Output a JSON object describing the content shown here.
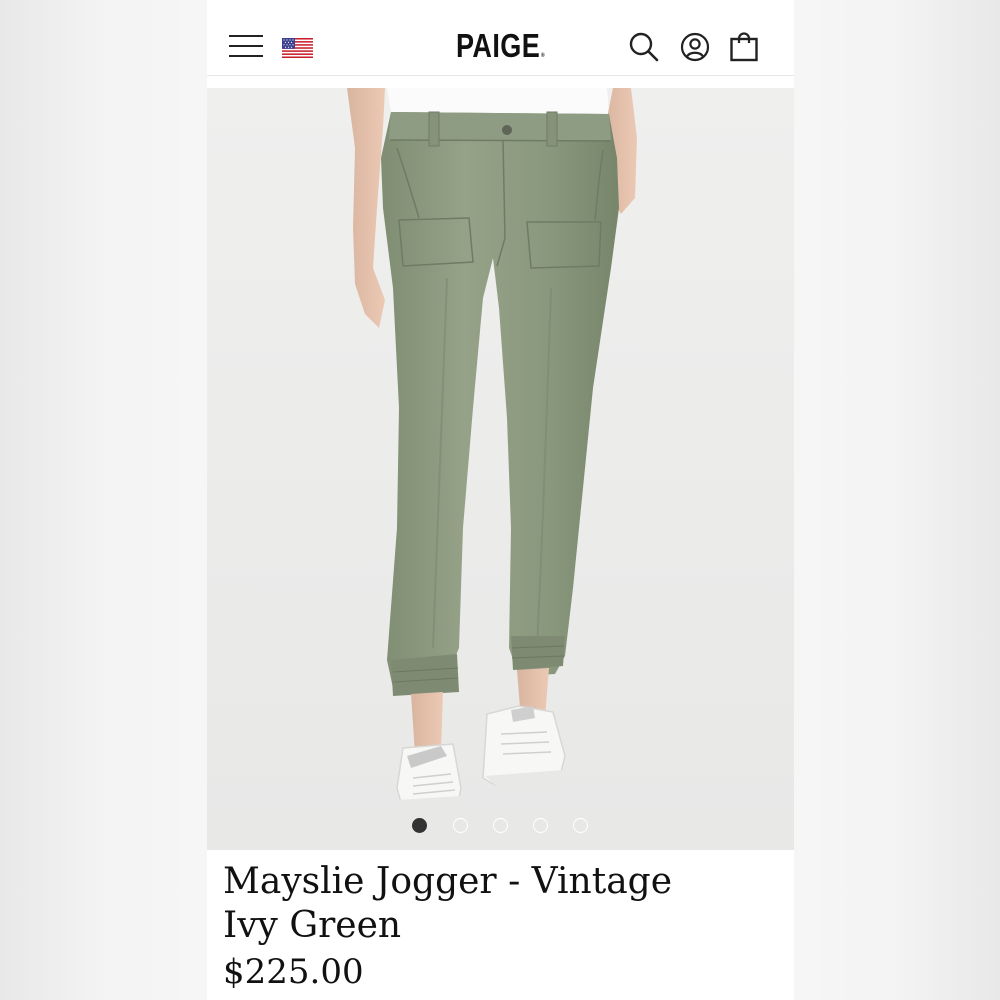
{
  "header": {
    "brand": "PAIGE",
    "brand_mark": "®",
    "icons": [
      "menu-icon",
      "us-flag-icon",
      "search-icon",
      "account-icon",
      "shopping-bag-icon"
    ]
  },
  "gallery": {
    "image_count": 5,
    "active_index": 0
  },
  "product": {
    "title_line1": "Mayslie Jogger - Vintage",
    "title_line2": "Ivy Green",
    "price": "$225.00",
    "color_hex": "#8c9a80"
  },
  "colors": {
    "text": "#111111",
    "background": "#ffffff",
    "gallery_bg": "#efefee",
    "pants": "#8c9a80"
  }
}
